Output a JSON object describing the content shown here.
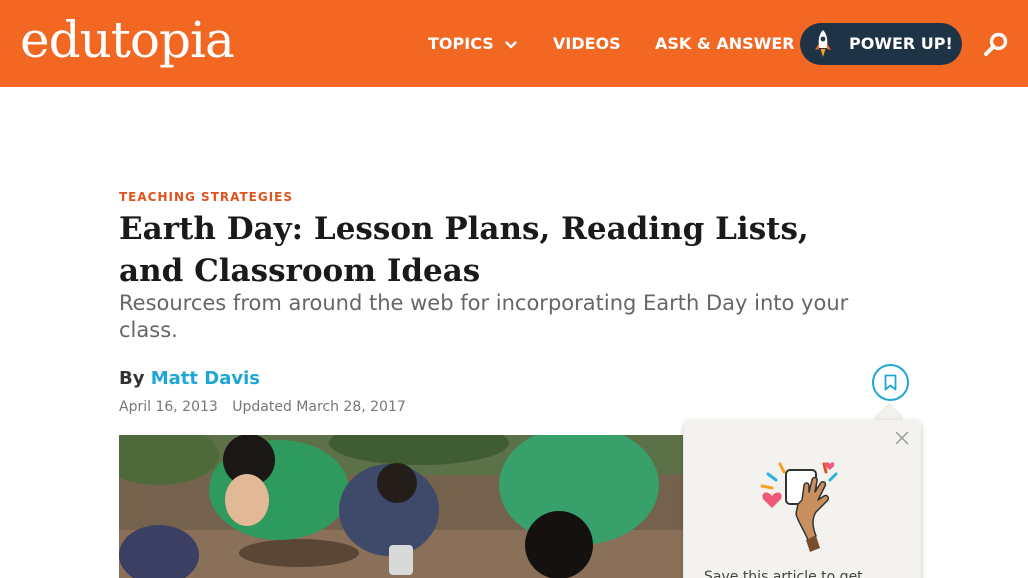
{
  "header": {
    "logo": "edutopia",
    "nav": {
      "topics": "TOPICS",
      "videos": "VIDEOS",
      "ask": "ASK & ANSWER"
    },
    "powerup": "POWER UP!",
    "icons": [
      "chevron-down-icon",
      "rocket-icon",
      "search-icon"
    ]
  },
  "article": {
    "kicker": "TEACHING STRATEGIES",
    "title": "Earth Day: Lesson Plans, Reading Lists, and Classroom Ideas",
    "subtitle": "Resources from around the web for incorporating Earth Day into your class.",
    "by": "By",
    "author": "Matt Davis",
    "published": "April 16, 2013",
    "updated": "Updated March 28, 2017"
  },
  "popup": {
    "text": "Save this article to get"
  },
  "colors": {
    "brand_orange": "#f26722",
    "navy": "#1f3347",
    "link_blue": "#1ea7d6",
    "kicker_orange": "#e0531c"
  }
}
